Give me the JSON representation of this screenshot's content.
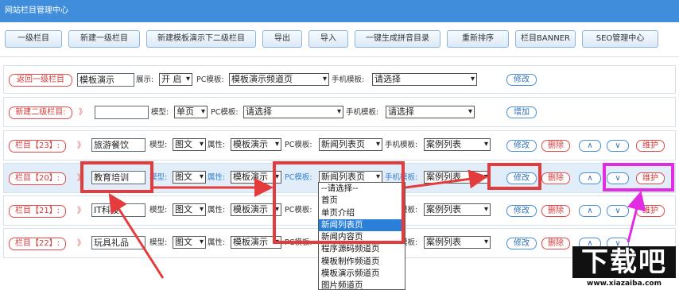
{
  "window": {
    "title": "网站栏目管理中心"
  },
  "toolbar": [
    "一级栏目",
    "新建一级栏目",
    "新建模板演示下二级栏目",
    "导出",
    "导入",
    "一键生成拼音目录",
    "重新排序",
    "栏目BANNER",
    "SEO管理中心"
  ],
  "row0": {
    "back_label": "返回一级栏目",
    "name_value": "模板演示",
    "show_label": "展示:",
    "show_value": "开 启",
    "pc_label": "PC模板:",
    "pc_value": "模板演示频道页",
    "mobile_label": "手机模板:",
    "mobile_value": "请选择",
    "edit": "修改"
  },
  "row1": {
    "new_label": "新建二级栏目:",
    "arrow": "》",
    "name_value": "",
    "type_label": "模型:",
    "type_value": "单页",
    "pc_label": "PC模板:",
    "pc_value": "请选择",
    "mobile_label": "手机模板:",
    "mobile_value": "请选择",
    "add": "增加"
  },
  "rows": [
    {
      "id_label": "栏目【23】:",
      "arrow": "》",
      "name": "旅游餐饮",
      "type_label": "模型:",
      "type_value": "图文",
      "attr_label": "属性:",
      "attr_value": "模板演示",
      "pc_label": "PC模板:",
      "pc_value": "新闻列表页",
      "mobile_label": "手机模板:",
      "mobile_value": "案例列表",
      "edit": "修改",
      "delete": "删除",
      "up": "∧",
      "down": "∨",
      "maintain": "维护"
    },
    {
      "id_label": "栏目【20】:",
      "arrow": "》",
      "name": "教育培训",
      "type_label": "模型:",
      "type_value": "图文",
      "attr_label": "属性:",
      "attr_value": "模板演示",
      "pc_label": "PC模板:",
      "pc_value": "新闻列表页",
      "mobile_label": "手机模板:",
      "mobile_value": "案例列表",
      "edit": "修改",
      "delete": "删除",
      "up": "∧",
      "down": "∨",
      "maintain": "维护"
    },
    {
      "id_label": "栏目【21】:",
      "arrow": "》",
      "name": "IT科技",
      "type_label": "模型:",
      "type_value": "图文",
      "attr_label": "属性:",
      "attr_value": "模板演示",
      "pc_label": "PC模板:",
      "pc_value": "",
      "mobile_label": "手机模板:",
      "mobile_value": "案例列表",
      "edit": "修改",
      "delete": "删除",
      "up": "∧",
      "down": "∨",
      "maintain": "维护"
    },
    {
      "id_label": "栏目【22】:",
      "arrow": "》",
      "name": "玩具礼品",
      "type_label": "模型:",
      "type_value": "图文",
      "attr_label": "属性:",
      "attr_value": "模板演示",
      "pc_label": "PC模板:",
      "pc_value": "",
      "mobile_label": "手机模板:",
      "mobile_value": "案例列表",
      "edit": "修改",
      "delete": "删除",
      "up": "∧",
      "down": "∨",
      "maintain": "维护"
    }
  ],
  "dropdown": {
    "options": [
      "--请选择--",
      "首页",
      "单页介绍",
      "新闻列表页",
      "新闻内容页",
      "程序源码频道页",
      "模板制作频道页",
      "模板演示频道页",
      "图片频道页"
    ],
    "selected_index": 3
  },
  "watermark": {
    "main": "下载吧",
    "sub": "www.xiazaiba.com"
  },
  "colors": {
    "header": "#3f8ddb",
    "red_button": "#d43a3a",
    "blue_button": "#2f6fb8",
    "highlight_row": "#e1eefa",
    "annotation_red": "#e43c3c",
    "annotation_magenta": "#e22ce2",
    "dropdown_selected": "#2a7fd9"
  }
}
